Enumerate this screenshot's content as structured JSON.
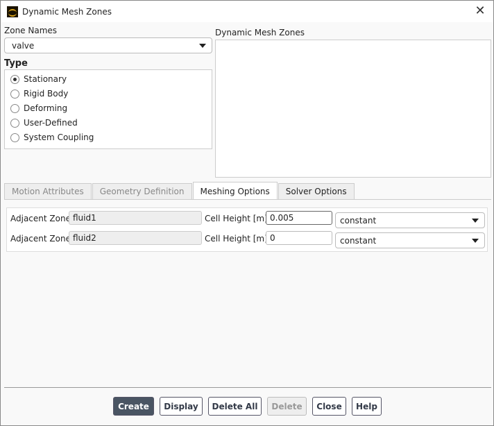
{
  "window": {
    "title": "Dynamic Mesh Zones"
  },
  "zone_names": {
    "label": "Zone Names",
    "value": "valve"
  },
  "dynamic_mesh_zones": {
    "label": "Dynamic Mesh Zones"
  },
  "type": {
    "label": "Type",
    "options": [
      {
        "label": "Stationary",
        "selected": true
      },
      {
        "label": "Rigid Body"
      },
      {
        "label": "Deforming"
      },
      {
        "label": "User-Defined"
      },
      {
        "label": "System Coupling"
      }
    ]
  },
  "tabs": [
    "Motion Attributes",
    "Geometry Definition",
    "Meshing Options",
    "Solver Options"
  ],
  "rows": [
    {
      "zone_label": "Adjacent Zone",
      "zone": "fluid1",
      "height_label": "Cell Height [m]",
      "height": "0.005",
      "method": "constant"
    },
    {
      "zone_label": "Adjacent Zone",
      "zone": "fluid2",
      "height_label": "Cell Height [m]",
      "height": "0",
      "method": "constant"
    }
  ],
  "buttons": {
    "create": "Create",
    "display": "Display",
    "delete_all": "Delete All",
    "delete": "Delete",
    "close": "Close",
    "help": "Help"
  }
}
